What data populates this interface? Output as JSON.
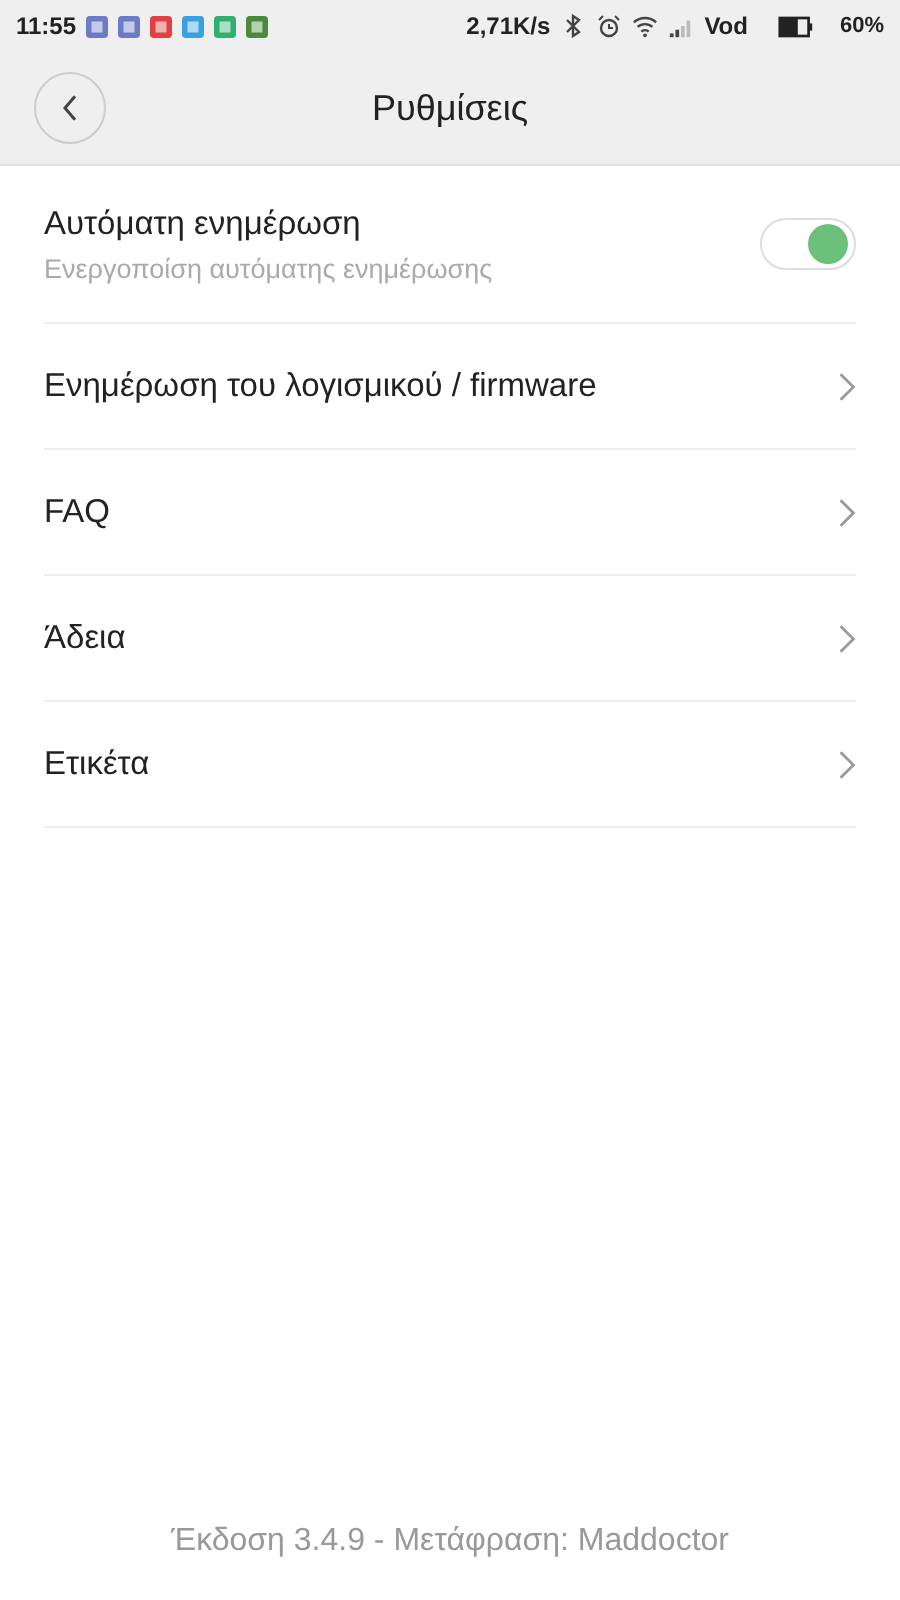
{
  "status_bar": {
    "time": "11:55",
    "speed": "2,71K/s",
    "carrier": "Vod",
    "battery": "60%"
  },
  "header": {
    "title": "Ρυθμίσεις"
  },
  "settings": [
    {
      "kind": "toggle",
      "label": "Αυτόματη ενημέρωση",
      "description": "Ενεργοποίση αυτόματης ενημέρωσης",
      "on": true
    },
    {
      "kind": "link",
      "label": "Ενημέρωση του λογισμικού / firmware"
    },
    {
      "kind": "link",
      "label": "FAQ"
    },
    {
      "kind": "link",
      "label": "Άδεια"
    },
    {
      "kind": "link",
      "label": "Ετικέτα"
    }
  ],
  "footer": "Έκδοση 3.4.9 - Μετάφραση: Maddoctor"
}
